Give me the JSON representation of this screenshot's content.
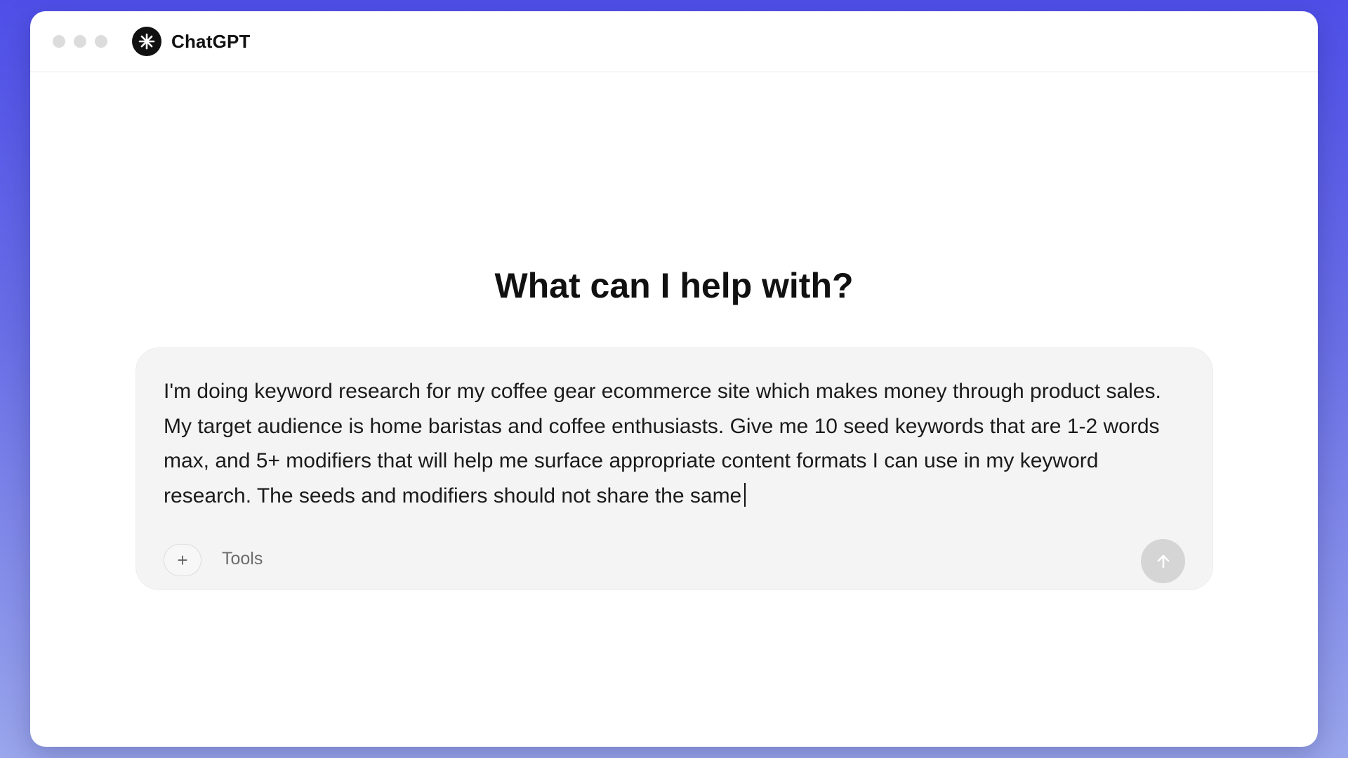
{
  "window": {
    "app_title": "ChatGPT",
    "traffic_lights": [
      "close",
      "minimize",
      "zoom"
    ]
  },
  "main": {
    "headline": "What can I help with?"
  },
  "composer": {
    "prompt_text": "I'm doing keyword research for my coffee gear ecommerce site which makes money through product sales. My target audience is home baristas and coffee enthusiasts. Give me 10 seed keywords that are 1-2 words max, and 5+ modifiers that will help me surface appropriate content formats I can use in my keyword research. The seeds and modifiers should not share the same",
    "add_label": "+",
    "tools_label": "Tools",
    "send_icon": "arrow-up-icon"
  },
  "icons": {
    "logo": "chatgpt-logo-icon",
    "add": "plus-icon",
    "send": "arrow-up-icon"
  },
  "colors": {
    "background_gradient_top": "#4f4fe8",
    "background_gradient_bottom": "#9aa6ec",
    "window_bg": "#ffffff",
    "composer_bg": "#f4f4f4",
    "send_button_disabled": "#d5d5d5",
    "text_primary": "#111111",
    "text_muted": "#6c6c6c"
  }
}
